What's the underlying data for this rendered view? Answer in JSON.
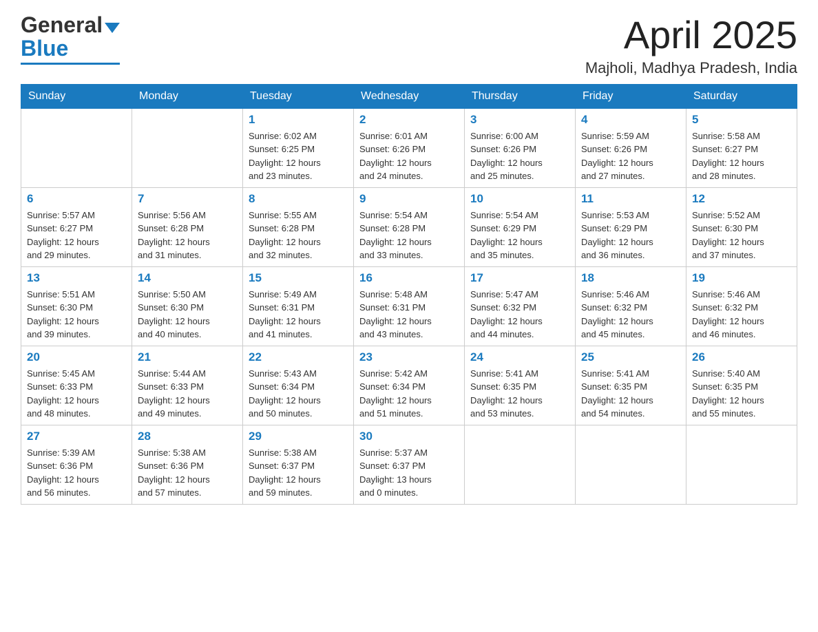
{
  "header": {
    "month_title": "April 2025",
    "location": "Majholi, Madhya Pradesh, India",
    "logo_general": "General",
    "logo_blue": "Blue"
  },
  "weekdays": [
    "Sunday",
    "Monday",
    "Tuesday",
    "Wednesday",
    "Thursday",
    "Friday",
    "Saturday"
  ],
  "weeks": [
    [
      {
        "day": "",
        "info": ""
      },
      {
        "day": "",
        "info": ""
      },
      {
        "day": "1",
        "info": "Sunrise: 6:02 AM\nSunset: 6:25 PM\nDaylight: 12 hours\nand 23 minutes."
      },
      {
        "day": "2",
        "info": "Sunrise: 6:01 AM\nSunset: 6:26 PM\nDaylight: 12 hours\nand 24 minutes."
      },
      {
        "day": "3",
        "info": "Sunrise: 6:00 AM\nSunset: 6:26 PM\nDaylight: 12 hours\nand 25 minutes."
      },
      {
        "day": "4",
        "info": "Sunrise: 5:59 AM\nSunset: 6:26 PM\nDaylight: 12 hours\nand 27 minutes."
      },
      {
        "day": "5",
        "info": "Sunrise: 5:58 AM\nSunset: 6:27 PM\nDaylight: 12 hours\nand 28 minutes."
      }
    ],
    [
      {
        "day": "6",
        "info": "Sunrise: 5:57 AM\nSunset: 6:27 PM\nDaylight: 12 hours\nand 29 minutes."
      },
      {
        "day": "7",
        "info": "Sunrise: 5:56 AM\nSunset: 6:28 PM\nDaylight: 12 hours\nand 31 minutes."
      },
      {
        "day": "8",
        "info": "Sunrise: 5:55 AM\nSunset: 6:28 PM\nDaylight: 12 hours\nand 32 minutes."
      },
      {
        "day": "9",
        "info": "Sunrise: 5:54 AM\nSunset: 6:28 PM\nDaylight: 12 hours\nand 33 minutes."
      },
      {
        "day": "10",
        "info": "Sunrise: 5:54 AM\nSunset: 6:29 PM\nDaylight: 12 hours\nand 35 minutes."
      },
      {
        "day": "11",
        "info": "Sunrise: 5:53 AM\nSunset: 6:29 PM\nDaylight: 12 hours\nand 36 minutes."
      },
      {
        "day": "12",
        "info": "Sunrise: 5:52 AM\nSunset: 6:30 PM\nDaylight: 12 hours\nand 37 minutes."
      }
    ],
    [
      {
        "day": "13",
        "info": "Sunrise: 5:51 AM\nSunset: 6:30 PM\nDaylight: 12 hours\nand 39 minutes."
      },
      {
        "day": "14",
        "info": "Sunrise: 5:50 AM\nSunset: 6:30 PM\nDaylight: 12 hours\nand 40 minutes."
      },
      {
        "day": "15",
        "info": "Sunrise: 5:49 AM\nSunset: 6:31 PM\nDaylight: 12 hours\nand 41 minutes."
      },
      {
        "day": "16",
        "info": "Sunrise: 5:48 AM\nSunset: 6:31 PM\nDaylight: 12 hours\nand 43 minutes."
      },
      {
        "day": "17",
        "info": "Sunrise: 5:47 AM\nSunset: 6:32 PM\nDaylight: 12 hours\nand 44 minutes."
      },
      {
        "day": "18",
        "info": "Sunrise: 5:46 AM\nSunset: 6:32 PM\nDaylight: 12 hours\nand 45 minutes."
      },
      {
        "day": "19",
        "info": "Sunrise: 5:46 AM\nSunset: 6:32 PM\nDaylight: 12 hours\nand 46 minutes."
      }
    ],
    [
      {
        "day": "20",
        "info": "Sunrise: 5:45 AM\nSunset: 6:33 PM\nDaylight: 12 hours\nand 48 minutes."
      },
      {
        "day": "21",
        "info": "Sunrise: 5:44 AM\nSunset: 6:33 PM\nDaylight: 12 hours\nand 49 minutes."
      },
      {
        "day": "22",
        "info": "Sunrise: 5:43 AM\nSunset: 6:34 PM\nDaylight: 12 hours\nand 50 minutes."
      },
      {
        "day": "23",
        "info": "Sunrise: 5:42 AM\nSunset: 6:34 PM\nDaylight: 12 hours\nand 51 minutes."
      },
      {
        "day": "24",
        "info": "Sunrise: 5:41 AM\nSunset: 6:35 PM\nDaylight: 12 hours\nand 53 minutes."
      },
      {
        "day": "25",
        "info": "Sunrise: 5:41 AM\nSunset: 6:35 PM\nDaylight: 12 hours\nand 54 minutes."
      },
      {
        "day": "26",
        "info": "Sunrise: 5:40 AM\nSunset: 6:35 PM\nDaylight: 12 hours\nand 55 minutes."
      }
    ],
    [
      {
        "day": "27",
        "info": "Sunrise: 5:39 AM\nSunset: 6:36 PM\nDaylight: 12 hours\nand 56 minutes."
      },
      {
        "day": "28",
        "info": "Sunrise: 5:38 AM\nSunset: 6:36 PM\nDaylight: 12 hours\nand 57 minutes."
      },
      {
        "day": "29",
        "info": "Sunrise: 5:38 AM\nSunset: 6:37 PM\nDaylight: 12 hours\nand 59 minutes."
      },
      {
        "day": "30",
        "info": "Sunrise: 5:37 AM\nSunset: 6:37 PM\nDaylight: 13 hours\nand 0 minutes."
      },
      {
        "day": "",
        "info": ""
      },
      {
        "day": "",
        "info": ""
      },
      {
        "day": "",
        "info": ""
      }
    ]
  ]
}
